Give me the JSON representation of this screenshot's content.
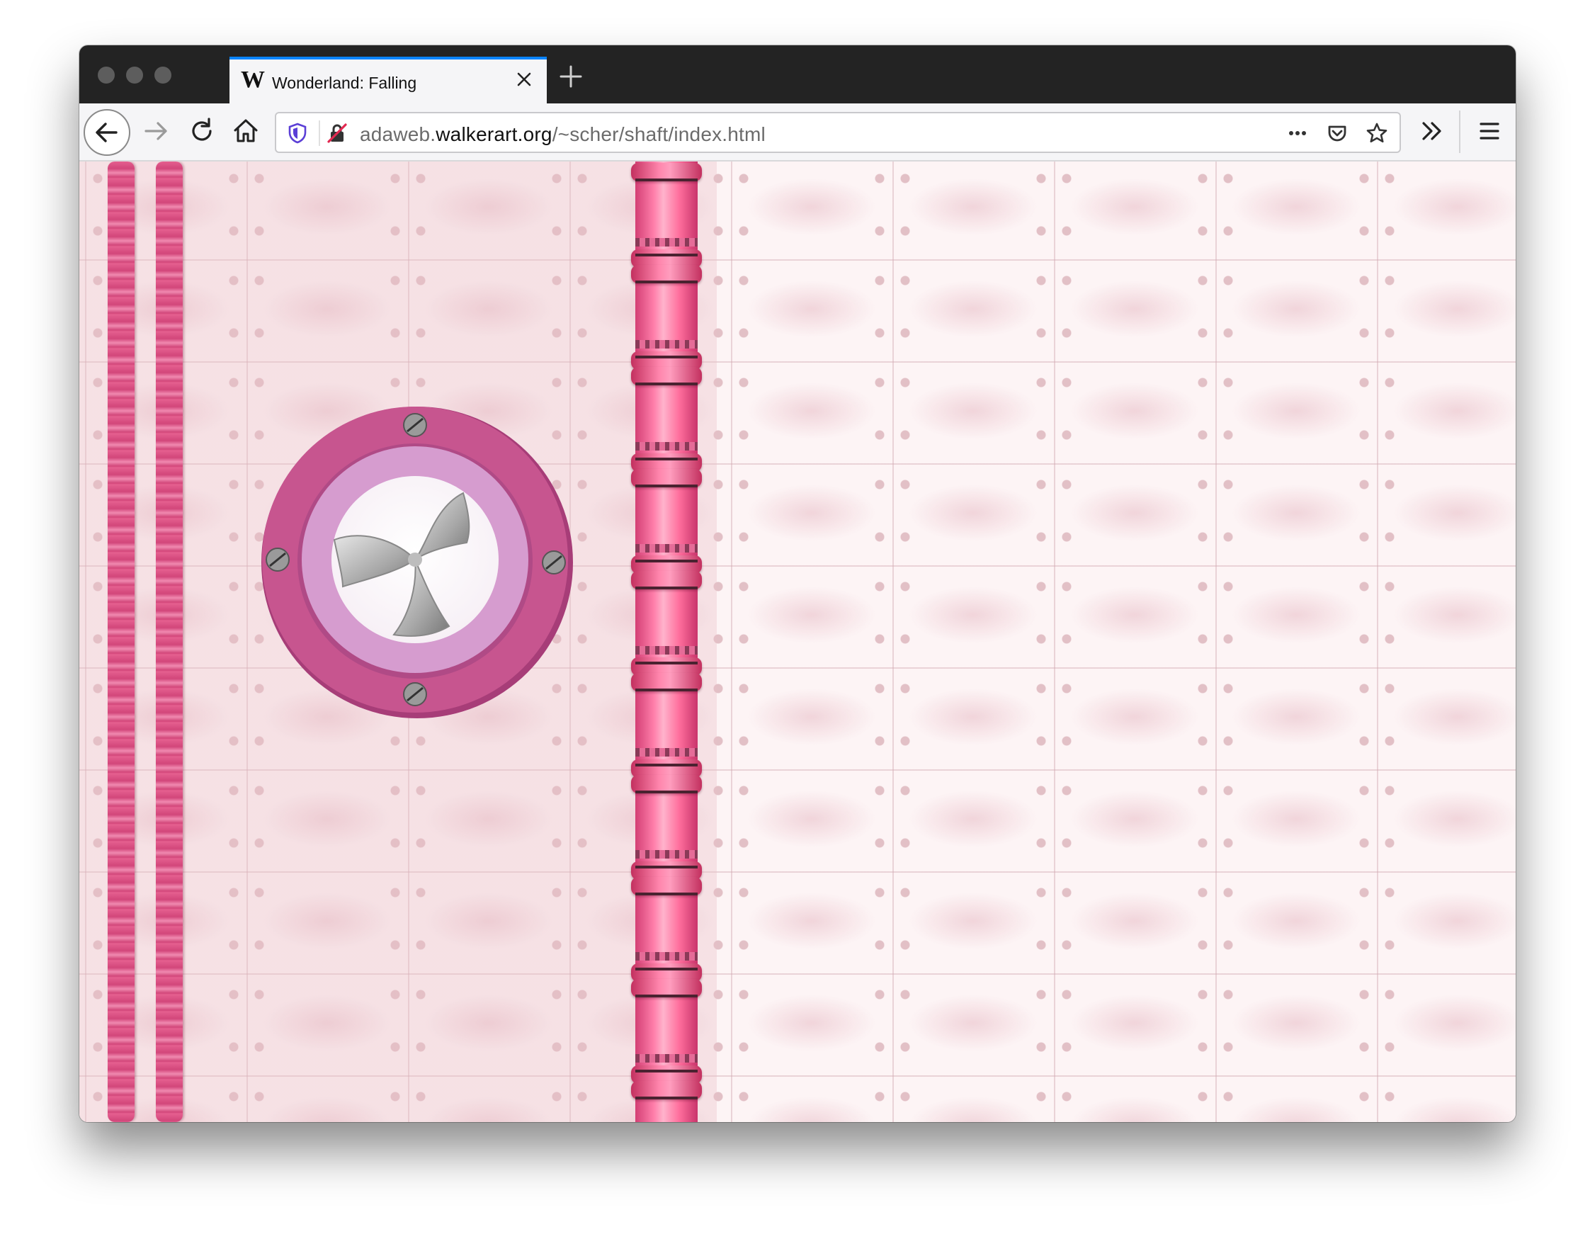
{
  "window": {
    "tab": {
      "favicon_letter": "W",
      "title": "Wonderland: Falling"
    },
    "navbar": {
      "url_prefix": "adaweb.",
      "url_domain": "walkerart.org",
      "url_path": "/~scher/shaft/index.html"
    }
  },
  "icons": {
    "back": "arrow-left-icon",
    "forward": "arrow-right-icon",
    "reload": "reload-icon",
    "home": "home-icon",
    "tracking": "shield-icon",
    "insecure": "insecure-lock-icon",
    "page_actions": "more-dots-icon",
    "pocket": "pocket-icon",
    "bookmark": "star-icon",
    "overflow": "double-chevron-icon",
    "menu": "hamburger-icon",
    "close_tab": "close-icon",
    "new_tab": "plus-icon"
  },
  "colors": {
    "accent": "#0a84ff",
    "titlebar": "#232323",
    "toolbar": "#f5f5f7",
    "pipe_pink": "#ff7fab",
    "porthole_ring": "#c7558f",
    "porthole_inner": "#d69ccf"
  }
}
